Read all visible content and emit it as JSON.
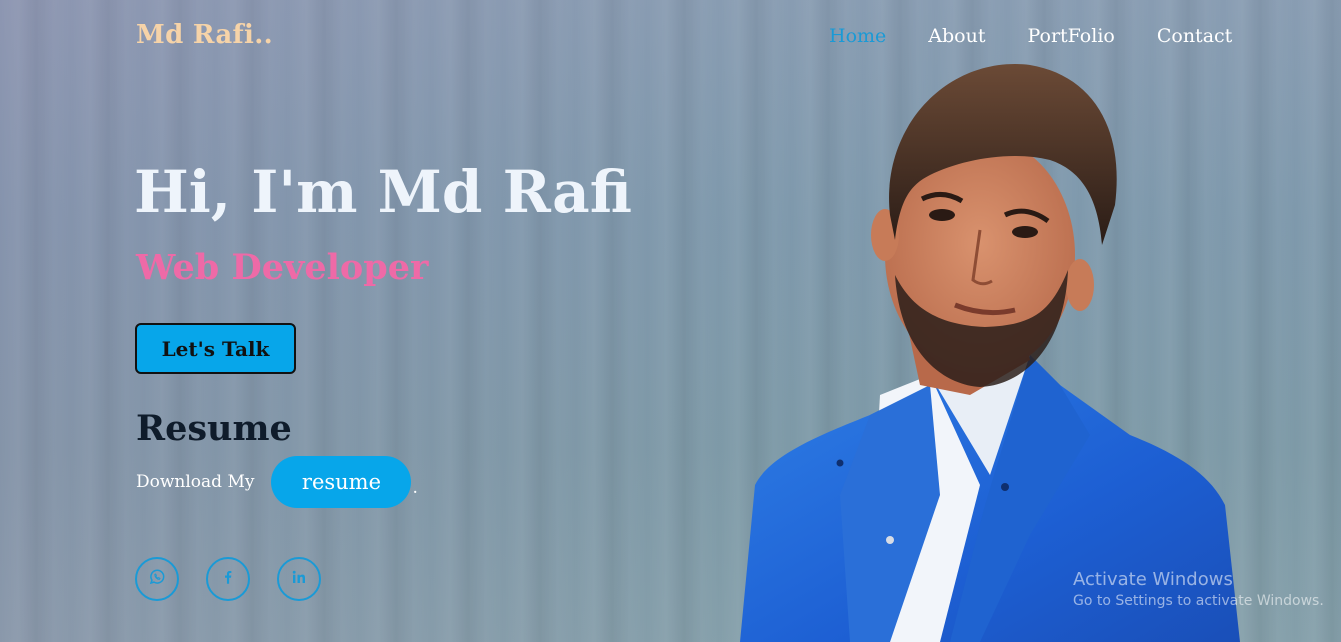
{
  "header": {
    "logo": "Md Rafi..",
    "nav": [
      {
        "label": "Home",
        "active": true
      },
      {
        "label": "About"
      },
      {
        "label": "PortFolio"
      },
      {
        "label": "Contact"
      }
    ]
  },
  "hero": {
    "title": "Hi, I'm Md Rafi",
    "subtitle": "Web Developer",
    "cta_label": "Let's Talk"
  },
  "resume": {
    "heading": "Resume",
    "download_text": "Download My",
    "button_label": "resume",
    "trailing": "."
  },
  "socials": [
    {
      "icon": "whatsapp-icon"
    },
    {
      "icon": "facebook-icon"
    },
    {
      "icon": "linkedin-icon"
    }
  ],
  "watermark": {
    "line1": "Activate Windows",
    "line2": "Go to Settings to activate Windows."
  },
  "colors": {
    "accent": "#07a6ea",
    "nav_active": "#1a9ad6",
    "logo": "#f6d3a8",
    "subtitle": "#ee6aa7",
    "resume_heading": "#0f1c2b"
  }
}
